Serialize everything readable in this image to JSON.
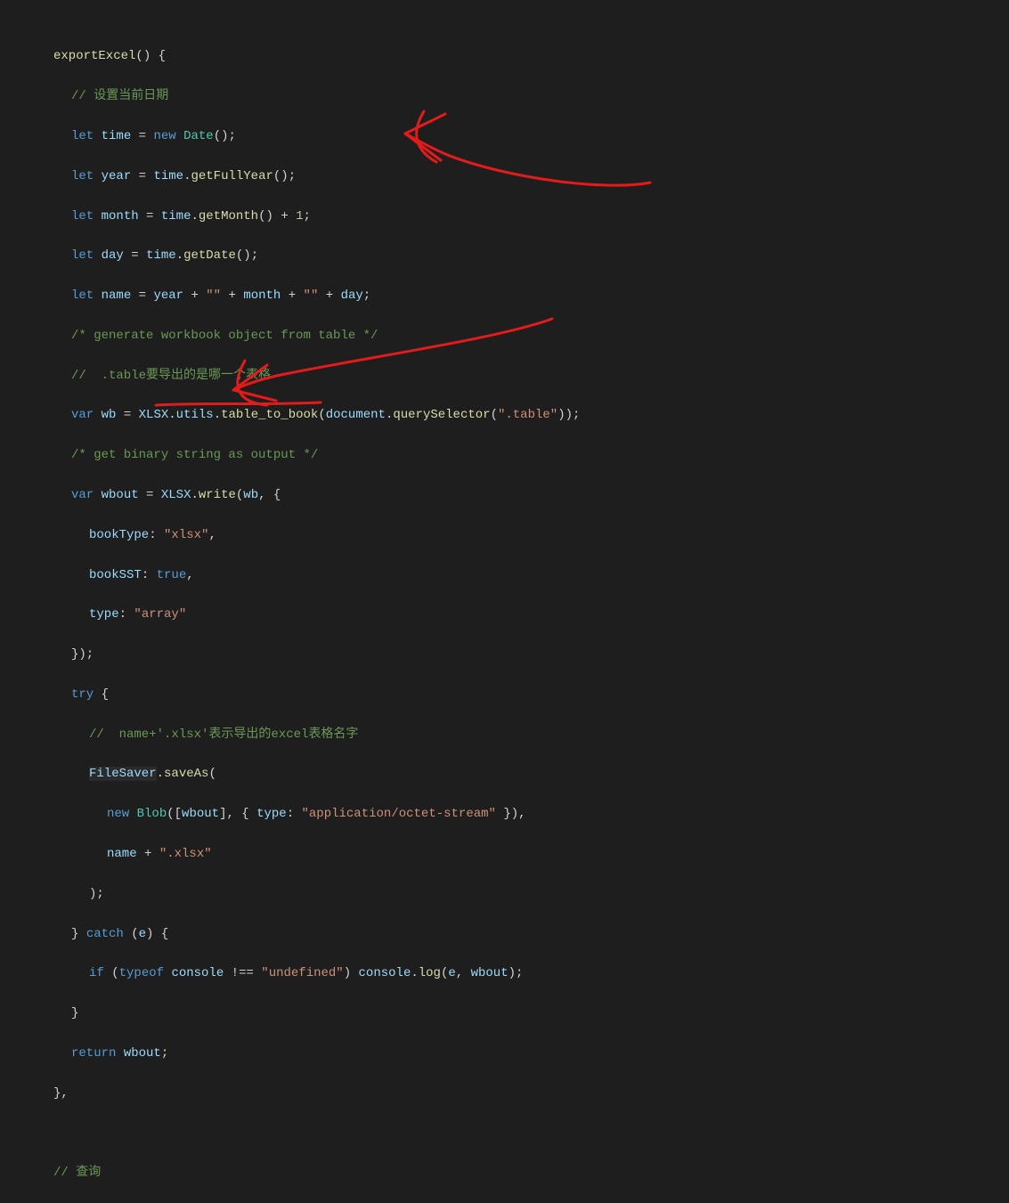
{
  "code": {
    "fn_name": "exportExcel",
    "c_setdate": "// 设置当前日期",
    "time_decl_time": "time",
    "date_ctor": "Date",
    "year_var": "year",
    "getFullYear": "getFullYear",
    "month_var": "month",
    "getMonth": "getMonth",
    "plus_one": "1",
    "day_var": "day",
    "getDate": "getDate",
    "name_var": "name",
    "empty_str": "\"\"",
    "c_gen": "/* generate workbook object from table */",
    "c_table": "//  .table要导出的是哪一个表格",
    "wb_var": "wb",
    "xlsx_obj": "XLSX",
    "utils": "utils",
    "table_to_book": "table_to_book",
    "document_obj": "document",
    "querySelector": "querySelector",
    "table_sel": "\".table\"",
    "c_binary": "/* get binary string as output */",
    "wbout_var": "wbout",
    "write": "write",
    "bookType_k": "bookType",
    "xlsx_v": "\"xlsx\"",
    "bookSST_k": "bookSST",
    "true_lit": "true",
    "type_k": "type",
    "array_v": "\"array\"",
    "try_kw": "try",
    "c_name_xlsx": "//  name+'.xlsx'表示导出的excel表格名字",
    "FileSaver": "FileSaver",
    "saveAs": "saveAs",
    "new_kw": "new",
    "Blob_ctor": "Blob",
    "app_octet": "\"application/octet-stream\"",
    "xlsx_ext": "\".xlsx\"",
    "catch_kw": "catch",
    "e_var": "e",
    "if_kw": "if",
    "typeof_kw": "typeof",
    "console_obj": "console",
    "undefined_str": "\"undefined\"",
    "log_fn": "log",
    "return_kw": "return",
    "c_query": "// 查询",
    "let_kw": "let",
    "var_kw": "var"
  }
}
